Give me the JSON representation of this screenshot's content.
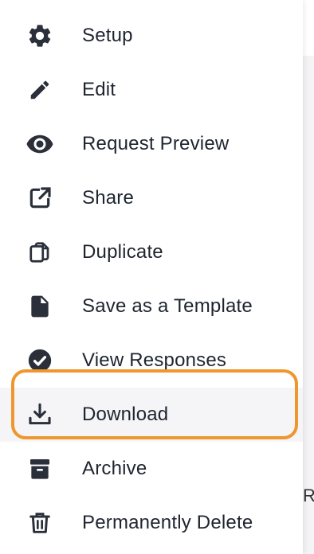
{
  "menu": {
    "items": [
      {
        "id": "setup",
        "label": "Setup",
        "icon": "gear-icon"
      },
      {
        "id": "edit",
        "label": "Edit",
        "icon": "pencil-icon"
      },
      {
        "id": "request-preview",
        "label": "Request Preview",
        "icon": "eye-icon"
      },
      {
        "id": "share",
        "label": "Share",
        "icon": "external-link-icon"
      },
      {
        "id": "duplicate",
        "label": "Duplicate",
        "icon": "copy-icon"
      },
      {
        "id": "save-template",
        "label": "Save as a Template",
        "icon": "file-icon"
      },
      {
        "id": "view-responses",
        "label": "View Responses",
        "icon": "check-circle-icon"
      },
      {
        "id": "download",
        "label": "Download",
        "icon": "download-icon",
        "highlighted": true
      },
      {
        "id": "archive",
        "label": "Archive",
        "icon": "archive-icon"
      },
      {
        "id": "delete",
        "label": "Permanently Delete",
        "icon": "trash-icon"
      }
    ]
  },
  "background": {
    "partial_text": "Re"
  },
  "colors": {
    "icon": "#2a2f3a",
    "text": "#1e2430",
    "highlight_border": "#f0962e",
    "highlight_bg": "#f5f5f7"
  }
}
